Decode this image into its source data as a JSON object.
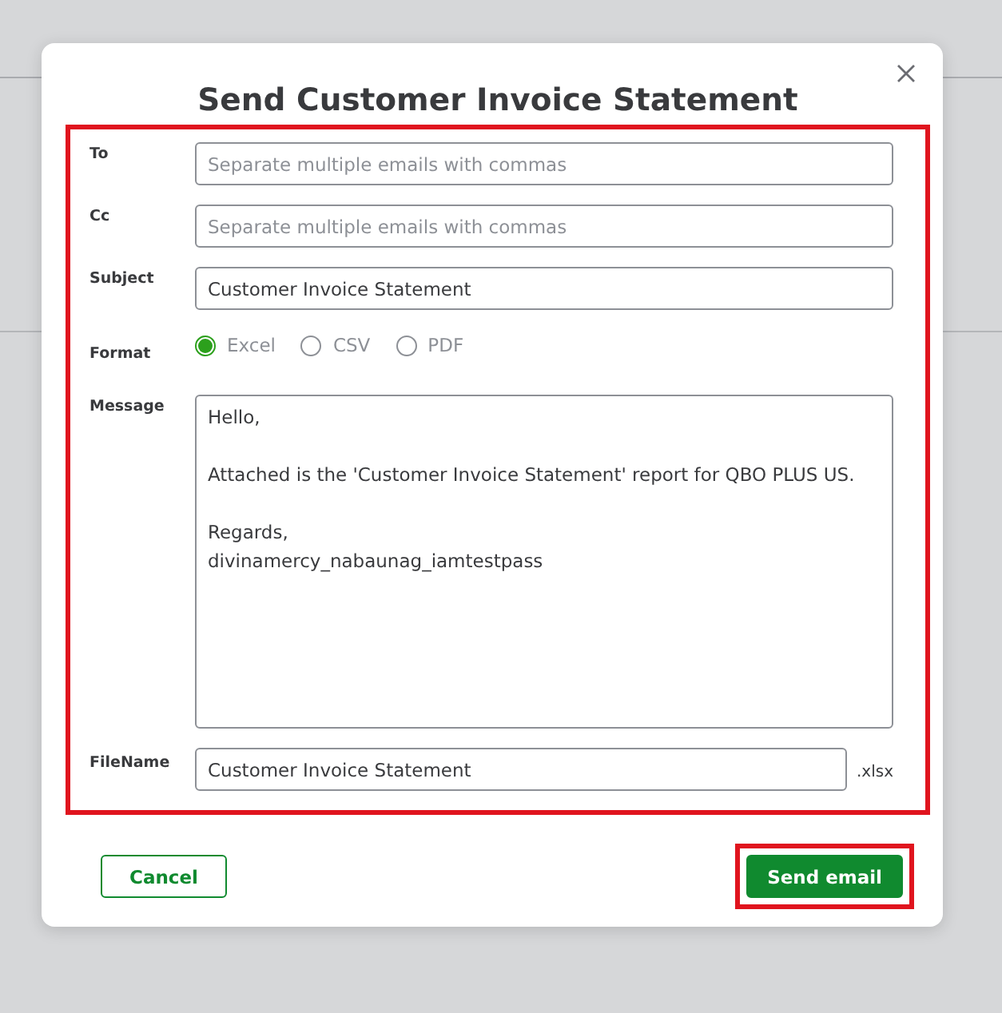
{
  "dialog": {
    "title": "Send Customer Invoice Statement",
    "form": {
      "highlighted": true,
      "fields": [
        {
          "label": "To",
          "placeholder": "Separate multiple emails with commas"
        },
        {
          "label": "Cc",
          "placeholder": "Separate multiple emails with commas"
        },
        {
          "label": "Subject",
          "value": "Customer Invoice Statement"
        }
      ],
      "format": {
        "label": "Format",
        "options": [
          {
            "label": "Excel",
            "selected": true
          },
          {
            "label": "CSV",
            "selected": false
          },
          {
            "label": "PDF",
            "selected": false
          }
        ]
      },
      "message": {
        "label": "Message",
        "value": "Hello,\n\nAttached is the 'Customer Invoice Statement' report for QBO PLUS US.\n\nRegards,\ndivinamercy_nabaunag_iamtestpass"
      },
      "filename": {
        "label": "FileName",
        "value": "Customer Invoice Statement",
        "extension": ".xlsx"
      }
    },
    "buttons": [
      {
        "label": "Cancel",
        "kind": "secondary",
        "highlighted": false
      },
      {
        "label": "Send email",
        "kind": "primary",
        "highlighted": true
      }
    ]
  }
}
